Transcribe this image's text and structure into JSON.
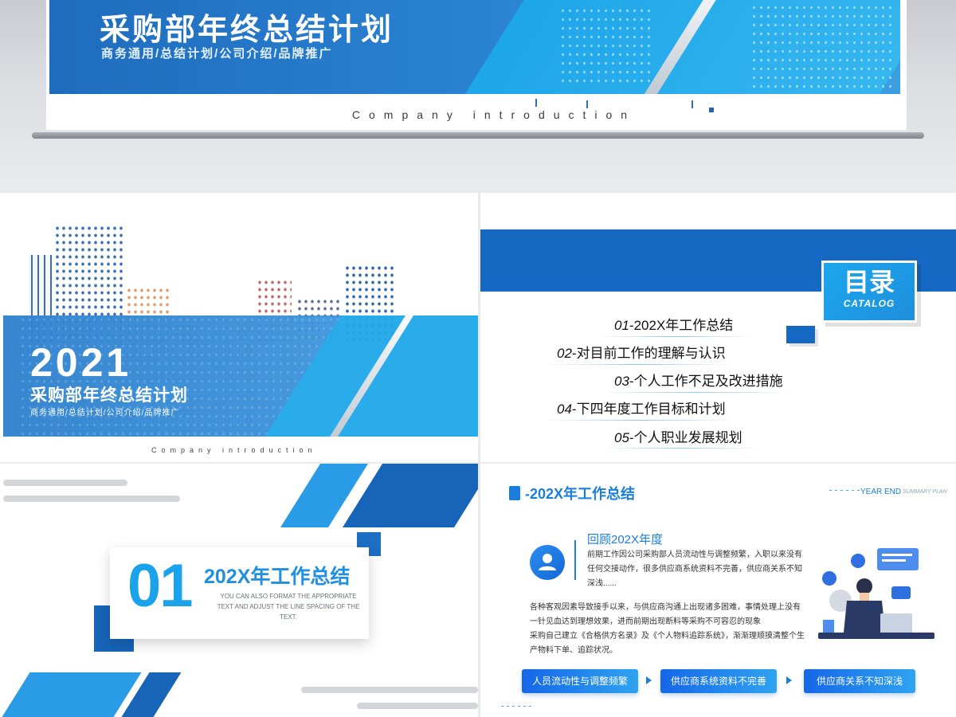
{
  "hero": {
    "title": "采购部年终总结计划",
    "subtitle": "商务通用/总结计划/公司介绍/品牌推广",
    "english": "Company introduction"
  },
  "cover": {
    "year": "2021",
    "title": "采购部年终总结计划",
    "subtitle": "商务通用/总结计划/公司介绍/品牌推广",
    "english": "Company introduction"
  },
  "catalog": {
    "title_zh": "目录",
    "title_en": "CATALOG",
    "items": [
      {
        "num": "01",
        "label": "-202X年工作总结"
      },
      {
        "num": "02",
        "label": "-对目前工作的理解与认识"
      },
      {
        "num": "03",
        "label": "-个人工作不足及改进措施"
      },
      {
        "num": "04",
        "label": "-下四年度工作目标和计划"
      },
      {
        "num": "05",
        "label": "-个人职业发展规划"
      }
    ]
  },
  "section": {
    "number": "01",
    "title": "202X年工作总结",
    "description": "YOU CAN ALSO FORMAT THE APPROPRIATE TEXT AND ADJUST THE LINE SPACING OF THE TEXT."
  },
  "review": {
    "title": "-202X年工作总结",
    "year_end": "YEAR END",
    "summary_plan": "SUMMARY PLAN",
    "heading": "回顾202X年度",
    "paragraph1": "前期工作因公司采购部人员流动性与调整频繁，入职以来没有任何交接动作，很多供应商系统资料不完善，供应商关系不知深浅......",
    "paragraph2": "各种客观因素导致接手以来，与供应商沟通上出现诸多困难，事情处理上没有一针见血达到理想效果，进而前期出现断料等采购不可容忍的现象",
    "paragraph3": "采购自己建立《合格供方名录》及《个人物料追踪系统》，渐渐理顺摸清整个生产物料下单、追踪状况。",
    "pills": [
      "人员流动性与调整频繁",
      "供应商系统资料不完善",
      "供应商关系不知深浅"
    ]
  },
  "colors": {
    "primary": "#1669c2",
    "accent": "#1aa2ea",
    "text": "#111111"
  }
}
